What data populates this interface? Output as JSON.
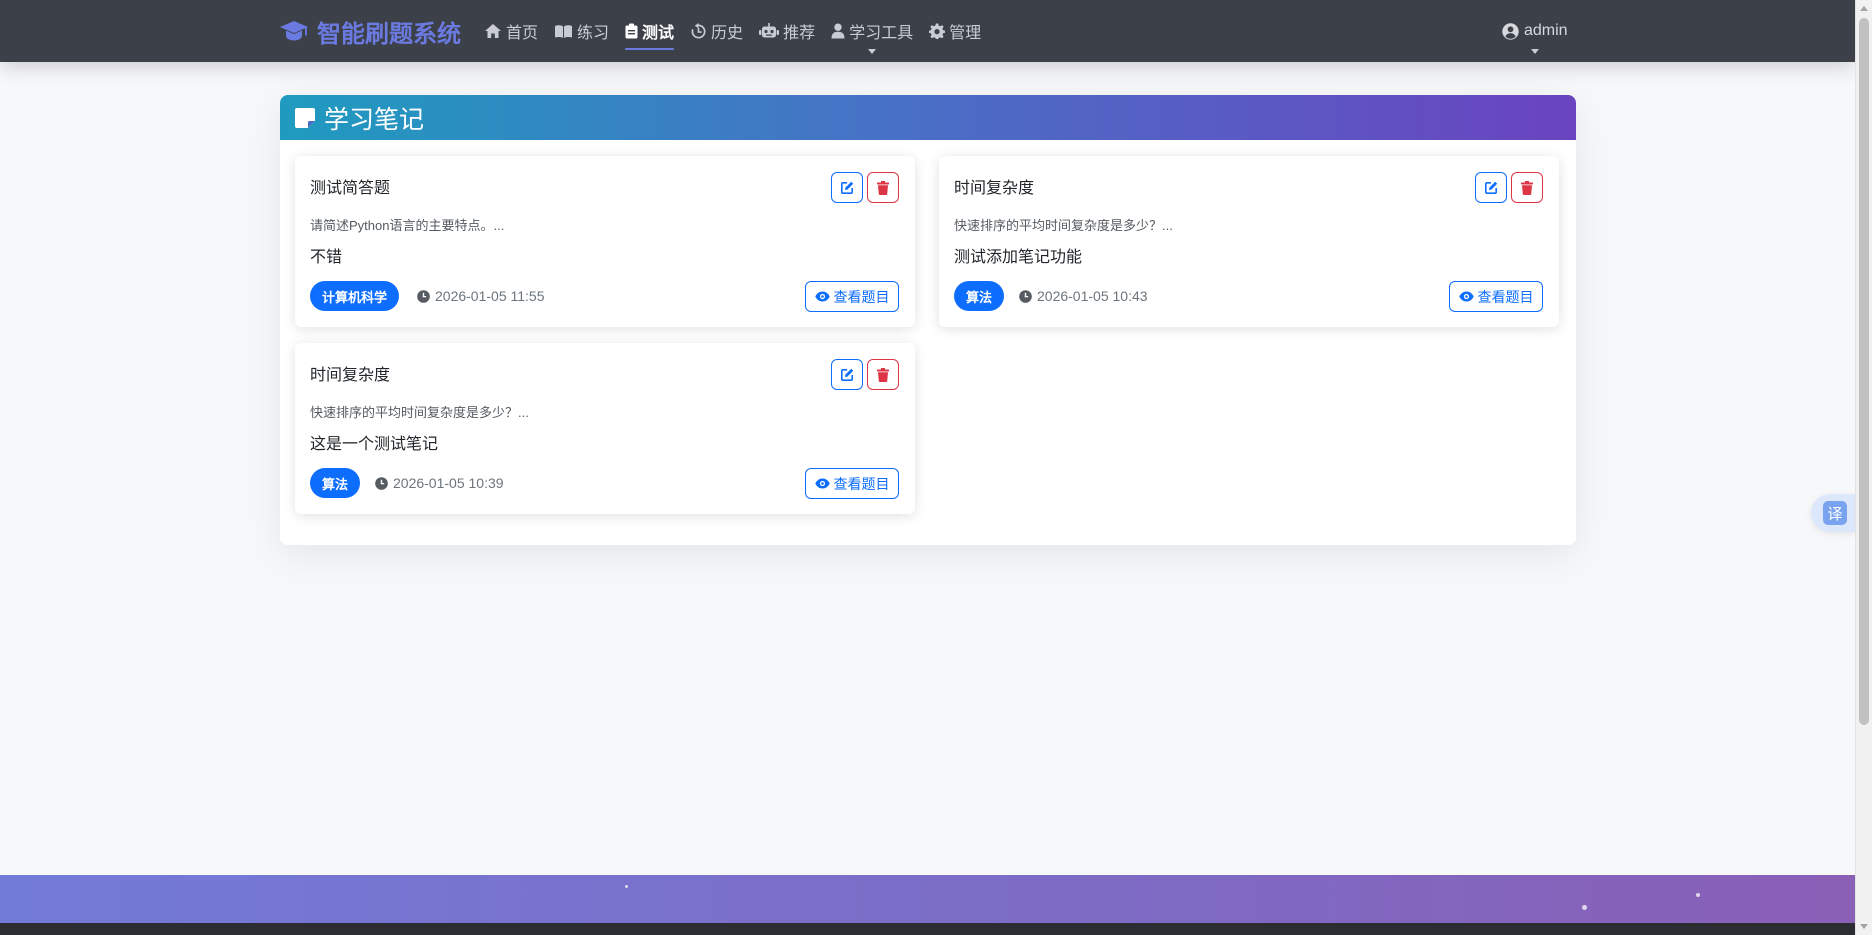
{
  "brand": {
    "name": "智能刷题系统",
    "icon": "graduation-cap-icon",
    "color": "#6b7ae0"
  },
  "nav": {
    "items": [
      {
        "label": "首页",
        "icon": "home-icon",
        "active": false
      },
      {
        "label": "练习",
        "icon": "book-icon",
        "active": false
      },
      {
        "label": "测试",
        "icon": "clipboard-icon",
        "active": true
      },
      {
        "label": "历史",
        "icon": "history-icon",
        "active": false
      },
      {
        "label": "推荐",
        "icon": "robot-icon",
        "active": false
      },
      {
        "label": "学习工具",
        "icon": "user-icon",
        "active": false,
        "dropdown": true
      },
      {
        "label": "管理",
        "icon": "gear-icon",
        "active": false
      }
    ],
    "user": {
      "name": "admin",
      "icon": "user-circle-icon"
    }
  },
  "page": {
    "title": "学习笔记",
    "title_icon": "sticky-note-icon",
    "header_gradient": [
      "#1f9bbf",
      "#6a44c0"
    ]
  },
  "notes": [
    {
      "title": "测试简答题",
      "question": "请简述Python语言的主要特点。...",
      "content": "不错",
      "tag": "计算机科学",
      "time": "2026-01-05 11:55",
      "view_label": "查看题目"
    },
    {
      "title": "时间复杂度",
      "question": "快速排序的平均时间复杂度是多少？...",
      "content": "测试添加笔记功能",
      "tag": "算法",
      "time": "2026-01-05 10:43",
      "view_label": "查看题目"
    },
    {
      "title": "时间复杂度",
      "question": "快速排序的平均时间复杂度是多少？...",
      "content": "这是一个测试笔记",
      "tag": "算法",
      "time": "2026-01-05 10:39",
      "view_label": "查看题目"
    }
  ],
  "translate": {
    "label": "译"
  },
  "colors": {
    "primary": "#0d6efd",
    "danger": "#dc3545",
    "navbar": "#3c4049"
  }
}
